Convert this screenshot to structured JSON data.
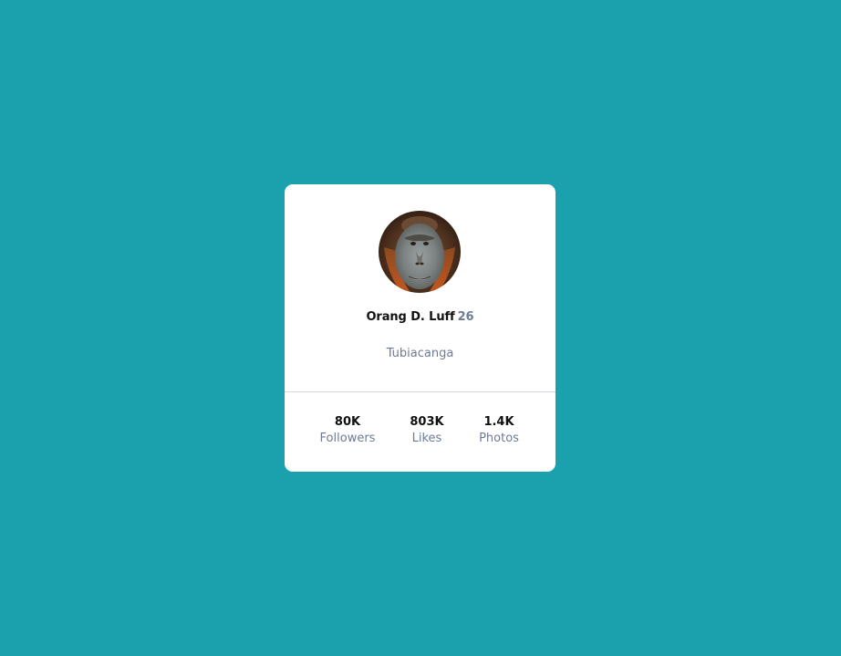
{
  "profile": {
    "name": "Orang D. Luff",
    "age": "26",
    "location": "Tubiacanga"
  },
  "stats": [
    {
      "value": "80K",
      "label": "Followers"
    },
    {
      "value": "803K",
      "label": "Likes"
    },
    {
      "value": "1.4K",
      "label": "Photos"
    }
  ],
  "colors": {
    "background": "#1aa1ad",
    "card": "#ffffff",
    "muted_text": "#6e7a96",
    "primary_text": "#111111"
  }
}
